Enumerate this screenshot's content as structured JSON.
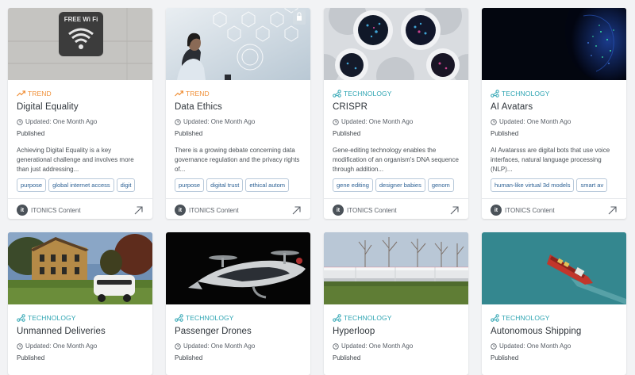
{
  "cards": [
    {
      "type": "TREND",
      "title": "Digital Equality",
      "updated": "Updated: One Month Ago",
      "status": "Published",
      "description": "Achieving Digital Equality is a key generational challenge and involves more than just addressing...",
      "tags": [
        "purpose",
        "global internet access",
        "digit"
      ],
      "owner": "ITONICS Content",
      "image_sign_text": "FREE Wi Fi"
    },
    {
      "type": "TREND",
      "title": "Data Ethics",
      "updated": "Updated: One Month Ago",
      "status": "Published",
      "description": "There is a growing debate concerning data governance regulation and the privacy rights of...",
      "tags": [
        "purpose",
        "digital trust",
        "ethical autom"
      ],
      "owner": "ITONICS Content"
    },
    {
      "type": "TECHNOLOGY",
      "title": "CRISPR",
      "updated": "Updated: One Month Ago",
      "status": "Published",
      "description": "Gene-editing technology enables the modification of an organism's DNA sequence through addition...",
      "tags": [
        "gene editing",
        "designer babies",
        "genom"
      ],
      "owner": "ITONICS Content"
    },
    {
      "type": "TECHNOLOGY",
      "title": "AI Avatars",
      "updated": "Updated: One Month Ago",
      "status": "Published",
      "description": "AI Avatarsss are digital bots that use voice interfaces, natural language processing (NLP)...",
      "tags": [
        "human-like virtual 3d models",
        "smart av"
      ],
      "owner": "ITONICS Content"
    },
    {
      "type": "TECHNOLOGY",
      "title": "Unmanned Deliveries",
      "updated": "Updated: One Month Ago",
      "status": "Published"
    },
    {
      "type": "TECHNOLOGY",
      "title": "Passenger Drones",
      "updated": "Updated: One Month Ago",
      "status": "Published"
    },
    {
      "type": "TECHNOLOGY",
      "title": "Hyperloop",
      "updated": "Updated: One Month Ago",
      "status": "Published"
    },
    {
      "type": "TECHNOLOGY",
      "title": "Autonomous Shipping",
      "updated": "Updated: One Month Ago",
      "status": "Published"
    }
  ],
  "logo_text": "it",
  "colors": {
    "trend": "#f0913a",
    "technology": "#2fa5b3",
    "tag_text": "#2a5f93"
  }
}
